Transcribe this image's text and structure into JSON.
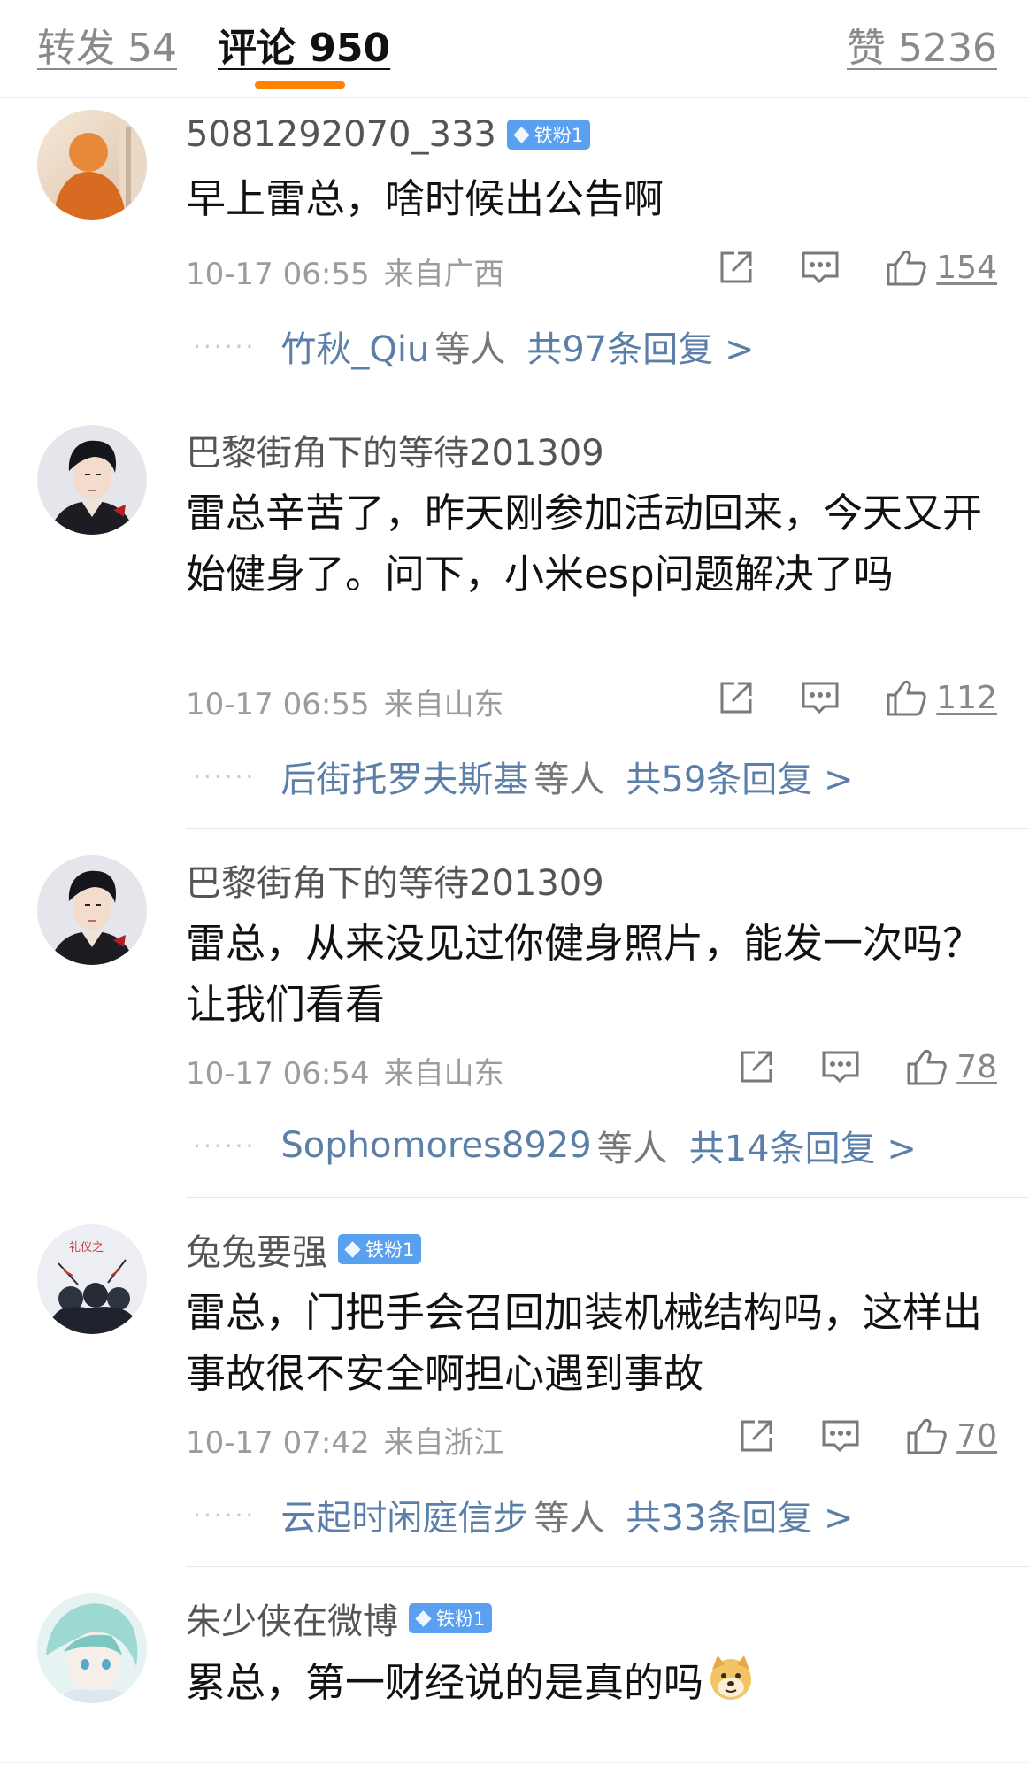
{
  "tabs": {
    "repost": "转发 54",
    "comments": "评论 950",
    "likes": "赞 5236"
  },
  "comments": [
    {
      "username": "5081292070_333",
      "badge": "铁粉1",
      "text": "早上雷总，啥时候出公告啊",
      "time": "10-17 06:55",
      "location": "来自广西",
      "likes": "154",
      "reply_names": "竹秋_Qiu",
      "reply_suffix": "等人",
      "reply_total": "共97条回复 >"
    },
    {
      "username": "巴黎街角下的等待201309",
      "text": "雷总辛苦了，昨天刚参加活动回来，今天又开始健身了。问下，小米esp问题解决了吗",
      "time": "10-17 06:55",
      "location": "来自山东",
      "likes": "112",
      "reply_names": "后街托罗夫斯基",
      "reply_suffix": "等人",
      "reply_total": "共59条回复 >"
    },
    {
      "username": "巴黎街角下的等待201309",
      "text": "雷总，从来没见过你健身照片，能发一次吗？让我们看看",
      "time": "10-17 06:54",
      "location": "来自山东",
      "likes": "78",
      "reply_names": "Sophomores8929",
      "reply_suffix": "等人",
      "reply_total": "共14条回复 >"
    },
    {
      "username": "兔兔要强",
      "badge": "铁粉1",
      "text": "雷总，门把手会召回加装机械结构吗，这样出事故很不安全啊担心遇到事故",
      "time": "10-17 07:42",
      "location": "来自浙江",
      "likes": "70",
      "reply_names": "云起时闲庭信步",
      "reply_suffix": "等人",
      "reply_total": "共33条回复 >"
    },
    {
      "username": "朱少侠在微博",
      "badge": "铁粉1",
      "text": "累总，第一财经说的是真的吗"
    }
  ],
  "avatar4_text": "礼仪之",
  "dots": "······",
  "colors": {
    "accent": "#ff8200",
    "link": "#5b7fa8",
    "badge": "#5aa0f0"
  }
}
